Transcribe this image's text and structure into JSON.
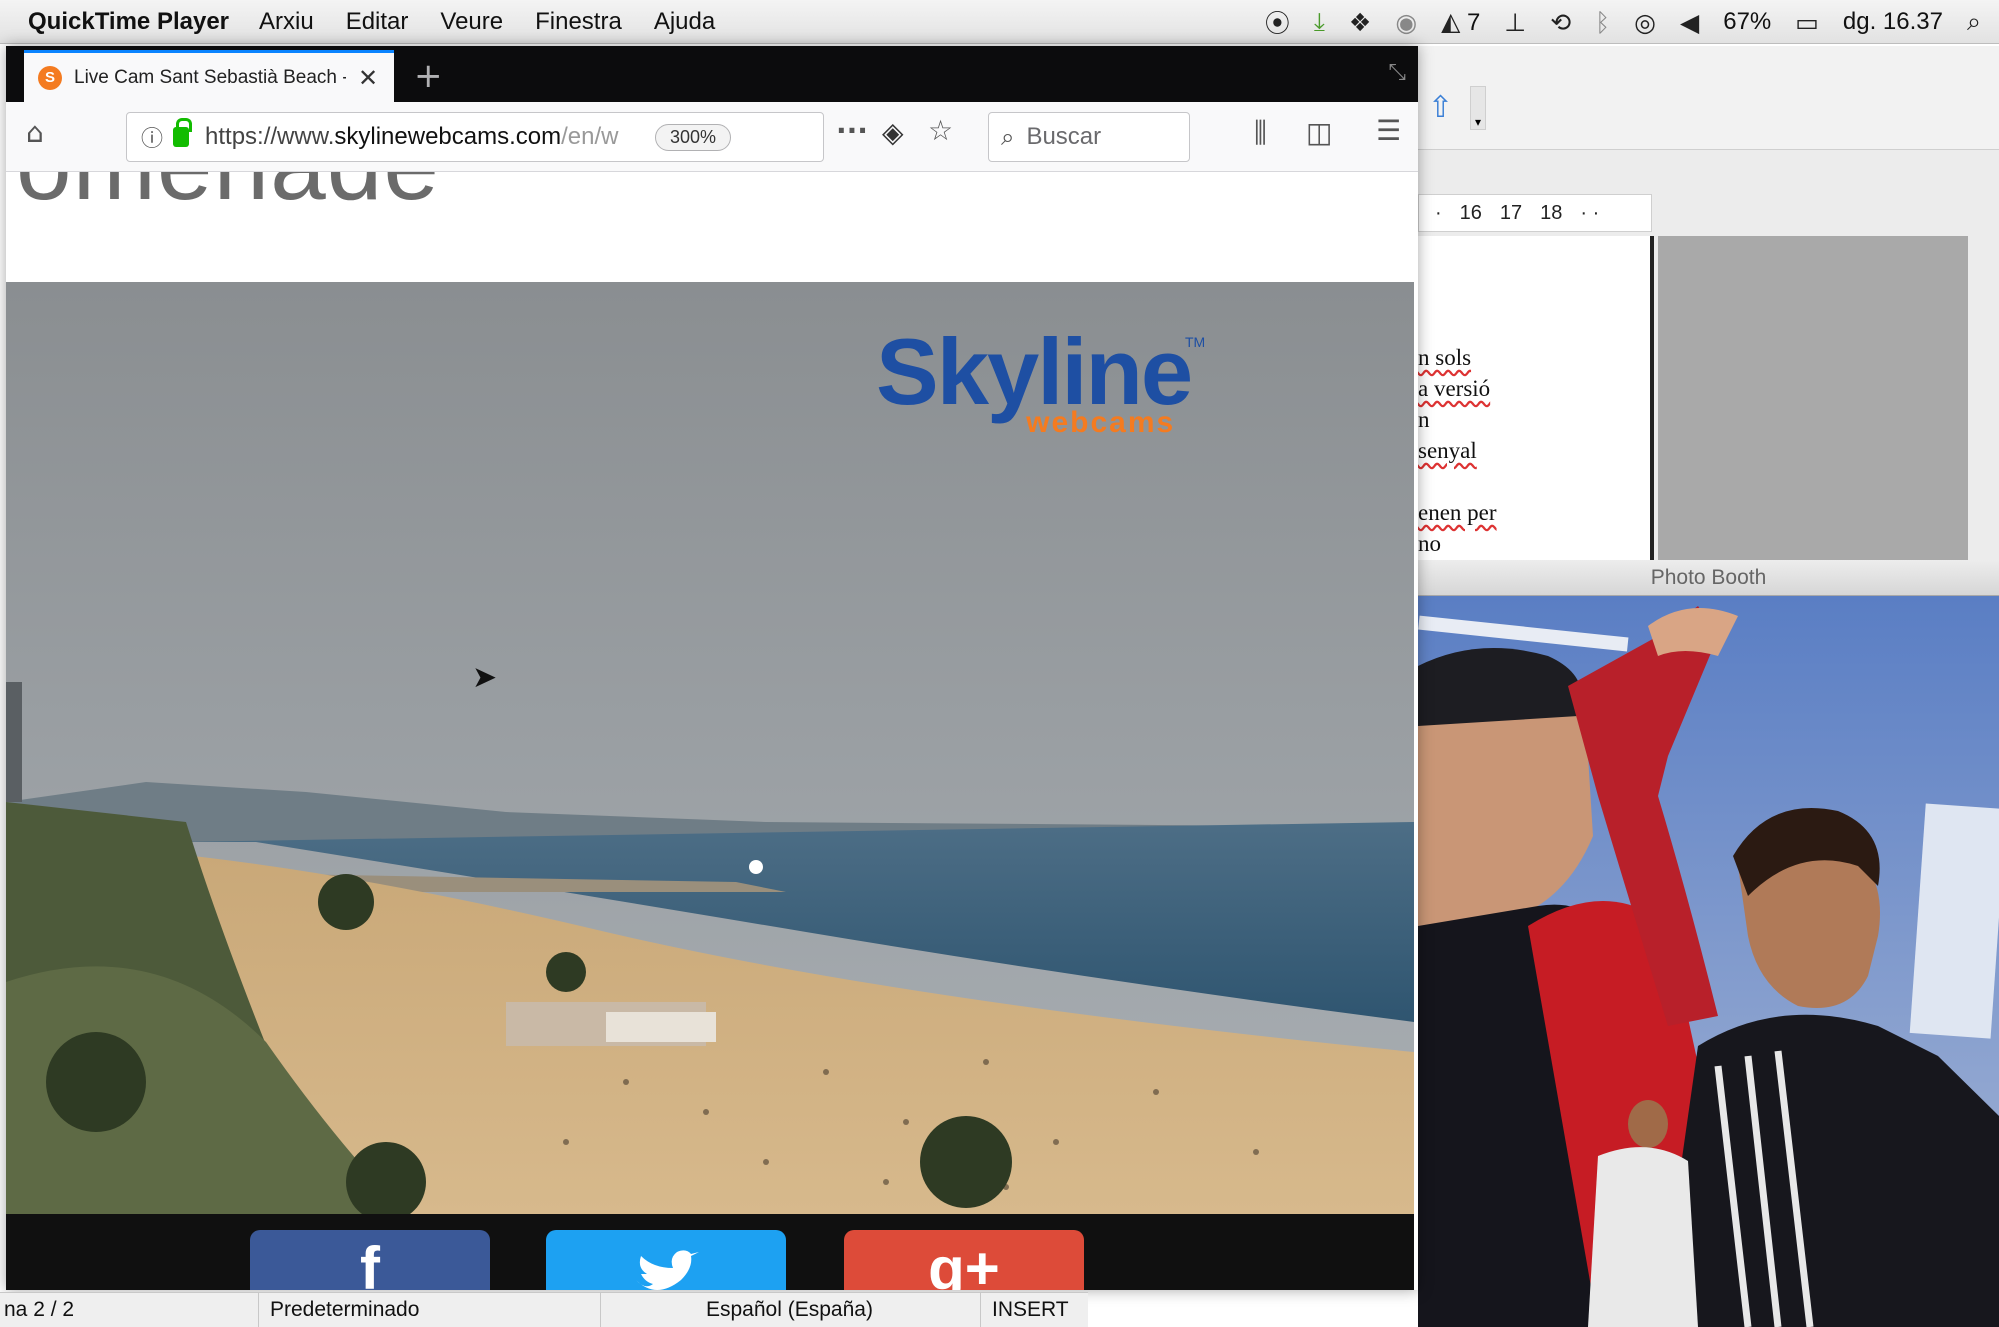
{
  "menubar": {
    "app_name": "QuickTime Player",
    "menus": [
      "Arxiu",
      "Editar",
      "Veure",
      "Finestra",
      "Ajuda"
    ],
    "status": {
      "badge_count": "7",
      "battery": "67%",
      "clock": "dg. 16.37"
    }
  },
  "browser": {
    "tab_title": "Live Cam Sant Sebastià Beach - ",
    "url_prefix": "https://www.",
    "url_domain": "skylinewebcams.com",
    "url_suffix": "/en/w",
    "zoom": "300%",
    "search_placeholder": "Buscar",
    "page_heading_fragment": "omenade",
    "logo_main": "Skyline",
    "logo_sub": "webcams",
    "logo_tm": "TM",
    "share_buttons": [
      {
        "label": "f",
        "color": "#3b5998"
      },
      {
        "label": "",
        "color": "#1da1f2"
      },
      {
        "label": "g+",
        "color": "#dd4b39"
      }
    ]
  },
  "document": {
    "ruler": [
      "16",
      "17",
      "18"
    ],
    "text_lines": [
      "n sols",
      "a versió",
      "n",
      "senyal",
      "",
      "enen per",
      "no"
    ]
  },
  "photobooth": {
    "title": "Photo Booth"
  },
  "statusbar": {
    "page": "na  2 / 2",
    "style": "Predeterminado",
    "language": "Español (España)",
    "mode": "INSERT"
  }
}
